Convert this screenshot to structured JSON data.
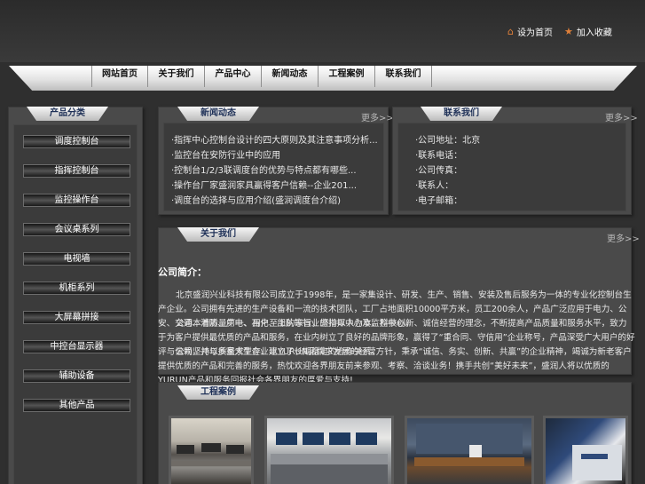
{
  "header": {
    "set_home": "设为首页",
    "add_favorite": "加入收藏"
  },
  "nav": [
    "网站首页",
    "关于我们",
    "产品中心",
    "新闻动态",
    "工程案例",
    "联系我们"
  ],
  "sidebar": {
    "title": "产品分类",
    "items": [
      "调度控制台",
      "指挥控制台",
      "监控操作台",
      "会议桌系列",
      "电视墙",
      "机柜系列",
      "大屏幕拼接",
      "中控台显示器",
      "辅助设备",
      "其他产品"
    ]
  },
  "news": {
    "title": "新闻动态",
    "more": "更多>>",
    "items": [
      "·指挥中心控制台设计的四大原则及其注意事项分析...",
      "·监控台在安防行业中的应用",
      "·控制台1/2/3联调度台的优势与特点都有哪些...",
      "·操作台厂家盛润家具赢得客户信赖--企业201...",
      "·调度台的选择与应用介绍(盛润调度台介绍)"
    ]
  },
  "contact": {
    "title": "联系我们",
    "more": "更多>>",
    "items": [
      "·公司地址：北京",
      "·联系电话：",
      "·公司传真：",
      "·联系人：",
      "·电子邮箱："
    ]
  },
  "about": {
    "title": "关于我们",
    "more": "更多>>",
    "heading": "公司简介：",
    "paragraphs": [
      "北京盛润兴业科技有限公司成立于1998年，是一家集设计、研发、生产、销售、安装及售后服务为一体的专业化控制台生产企业。公司拥有先进的生产设备和一流的技术团队，工厂占地面积10000平方米，员工200余人，产品广泛应用于电力、公安、交通、消防、广电、石化、部队等行业的指挥中心及监控中心。",
      "公司本着质量第一、用户至上的宗旨，坚持以人为本、科技创新、诚信经营的理念，不断提高产品质量和服务水平，致力于为客户提供最优质的产品和服务，在业内树立了良好的品牌形象，赢得了“重合同、守信用”企业称号，产品深受广大用户的好评与信赖，并与多家大型企业建立了长期稳定的合作关系。",
      "公司坚持以质量求生存、以YURUN品牌求发展的经营方针，秉承“诚信、务实、创新、共赢”的企业精神，竭诚为新老客户提供优质的产品和完善的服务，热忱欢迎各界朋友前来参观、考察、洽谈业务！携手共创“美好未来”，盛润人将以优质的YURUN产品和服务回报社会各界朋友的厚爱与支持!"
    ]
  },
  "cases": {
    "title": "工程案例"
  }
}
